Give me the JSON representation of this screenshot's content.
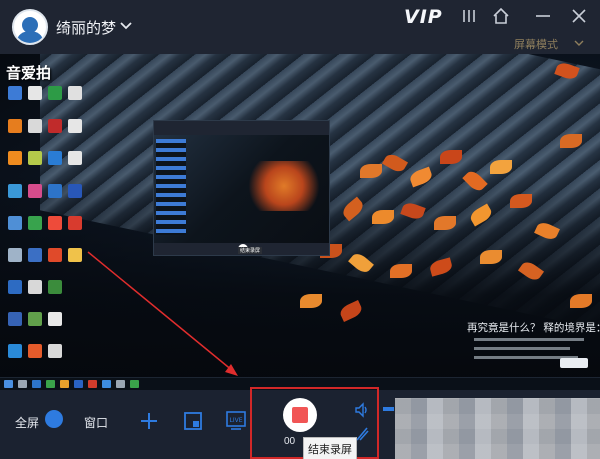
{
  "title_bar": {
    "username": "绮丽的梦",
    "vip_label": "VIP"
  },
  "screen_mode": {
    "label": "屏幕模式"
  },
  "preview": {
    "logo_text": "音爱拍",
    "nested_window_label": "结束录屏",
    "quote_title": "再究竟是什么？ 释的境界是："
  },
  "controls": {
    "full_screen_label": "全屏",
    "window_label": "窗口",
    "timer_text": "00",
    "stop_tooltip": "结束录屏",
    "volume_level": 0.05
  },
  "colors": {
    "accent": "#2e7be0",
    "record_red": "#f15555",
    "highlight_red": "#d22828"
  },
  "icons": [
    "user-avatar-icon",
    "chevron-down-icon",
    "home-icon",
    "minimize-icon",
    "close-icon",
    "plus-icon",
    "region-icon",
    "live-icon",
    "record-stop-icon",
    "speaker-icon",
    "microphone-icon"
  ]
}
